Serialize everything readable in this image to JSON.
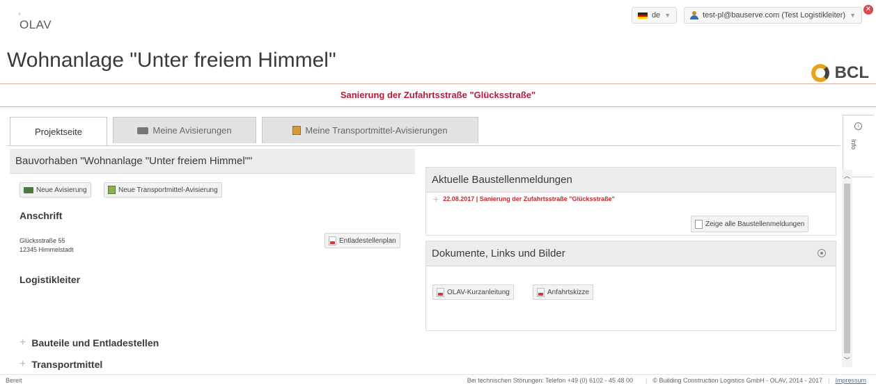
{
  "app": {
    "logo": "OLAV",
    "brand": "BCL"
  },
  "topbar": {
    "language": "de",
    "user": "test-pl@bauserve.com (Test Logistikleiter)"
  },
  "page_title": "Wohnanlage \"Unter freiem Himmel\"",
  "notice": "Sanierung der Zufahrtsstraße \"Glücksstraße\"",
  "tabs": [
    {
      "label": "Projektseite"
    },
    {
      "label": "Meine Avisierungen"
    },
    {
      "label": "Meine Transportmittel-Avisierungen"
    }
  ],
  "info_side": {
    "label": "Info"
  },
  "left": {
    "title": "Bauvorhaben \"Wohnanlage \"Unter freiem Himmel\"\"",
    "buttons": {
      "new_avis": "Neue Avisierung",
      "new_transport_avis": "Neue Transportmittel-Avisierung"
    },
    "address_title": "Anschrift",
    "address_lines": [
      "Glücksstraße 55",
      "12345 Himmelstadt"
    ],
    "unload_plan_button": "Entladestellenplan",
    "logistics_title": "Logistikleiter",
    "sections": [
      "Bauteile und Entladestellen",
      "Transportmittel"
    ]
  },
  "news": {
    "title": "Aktuelle Baustellenmeldungen",
    "item": "22.08.2017 | Sanierung der Zufahrtsstraße \"Glücksstraße\"",
    "show_all_button": "Zeige alle Baustellenmeldungen"
  },
  "docs": {
    "title": "Dokumente, Links und Bilder",
    "items": [
      "OLAV-Kurzanleitung",
      "Anfahrtskizze"
    ]
  },
  "footer": {
    "status": "Bereit",
    "support": "Bei technischen Störungen: Telefon +49 (0) 6102 - 45 48 00",
    "copyright": "© Building Construction Logistics GmbH - OLAV, 2014 - 2017",
    "imprint": "Impressum"
  },
  "colors": {
    "accent_red": "#b01c3a",
    "brand_orange": "#e8a31c"
  }
}
